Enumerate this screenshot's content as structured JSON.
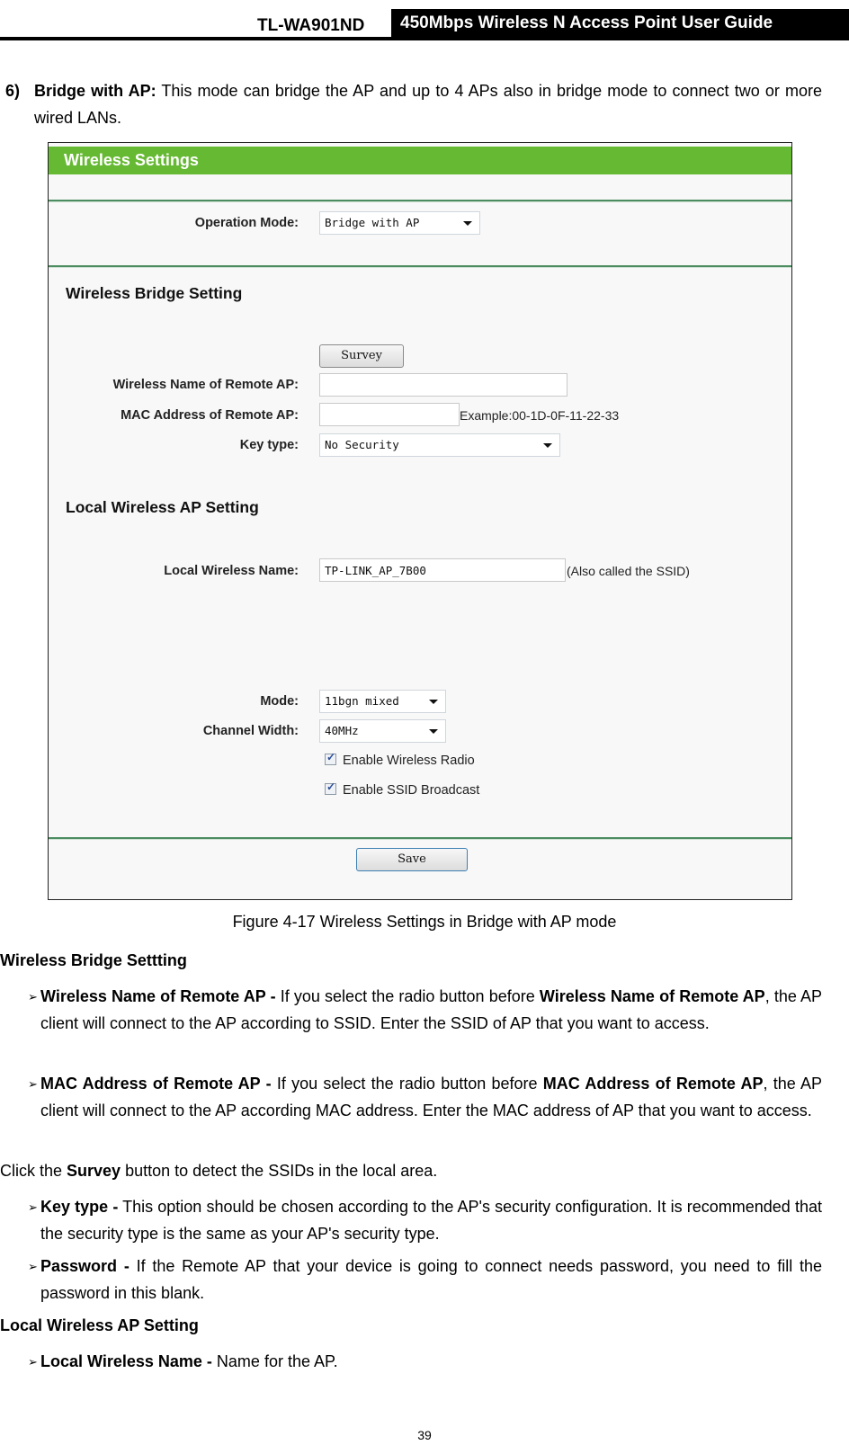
{
  "header": {
    "model": "TL-WA901ND",
    "title": "450Mbps Wireless N Access Point User Guide"
  },
  "intro": {
    "number": "6)",
    "term": "Bridge with AP:",
    "text": "This mode can bridge the AP and up to 4 APs also in bridge mode to connect two or more wired LANs."
  },
  "figure": {
    "panel_title": "Wireless Settings",
    "colors": {
      "title_bar": "#66b933",
      "rule": "#4b8d61"
    },
    "operation_mode": {
      "label": "Operation Mode:",
      "value": "Bridge with AP"
    },
    "bridge_section": {
      "title": "Wireless Bridge Setting",
      "survey_button": "Survey",
      "remote_name": {
        "label": "Wireless Name of Remote AP:",
        "value": ""
      },
      "remote_mac": {
        "label": "MAC Address of Remote AP:",
        "value": "",
        "hint": "Example:00-1D-0F-11-22-33"
      },
      "key_type": {
        "label": "Key type:",
        "value": "No Security"
      }
    },
    "local_section": {
      "title": "Local Wireless AP Setting",
      "local_name": {
        "label": "Local Wireless Name:",
        "value": "TP-LINK_AP_7B00",
        "hint": "(Also called the SSID)"
      },
      "mode": {
        "label": "Mode:",
        "value": "11bgn mixed"
      },
      "channel_width": {
        "label": "Channel Width:",
        "value": "40MHz"
      },
      "enable_radio": {
        "label": "Enable Wireless Radio",
        "checked": true
      },
      "enable_ssid": {
        "label": "Enable SSID Broadcast",
        "checked": true
      }
    },
    "save_button": "Save",
    "caption": "Figure 4-17 Wireless Settings in Bridge with AP mode"
  },
  "sections": {
    "bridge_heading": "Wireless Bridge Settting",
    "bullet1": {
      "term": "Wireless Name of Remote AP -",
      "text1": " If you select the radio button before ",
      "term2": "Wireless Name of Remote AP",
      "text2": ", the AP client will connect to the AP according to SSID. Enter the SSID of AP that you want to access."
    },
    "bullet2": {
      "term": "MAC Address of Remote AP -",
      "text1": " If you select the radio button before ",
      "term2": "MAC Address of Remote AP",
      "text2": ", the AP client will connect to the AP according MAC address. Enter the MAC address of AP that you want to access."
    },
    "survey_line": {
      "pre": "Click the ",
      "term": "Survey",
      "post": " button to detect the SSIDs in the local area."
    },
    "bullet3": {
      "term": "Key type -",
      "text": " This option should be chosen according to the AP's security configuration. It is recommended that the security type is the same as your AP's security type."
    },
    "bullet4": {
      "term": "Password -",
      "text": " If the Remote AP that your device is going to connect needs password, you need to fill the password in this blank."
    },
    "local_heading": "Local Wireless AP Setting",
    "bullet5": {
      "term": "Local Wireless Name -",
      "text": " Name for the AP."
    },
    "bullet_glyph": "➢"
  },
  "page_number": "39"
}
